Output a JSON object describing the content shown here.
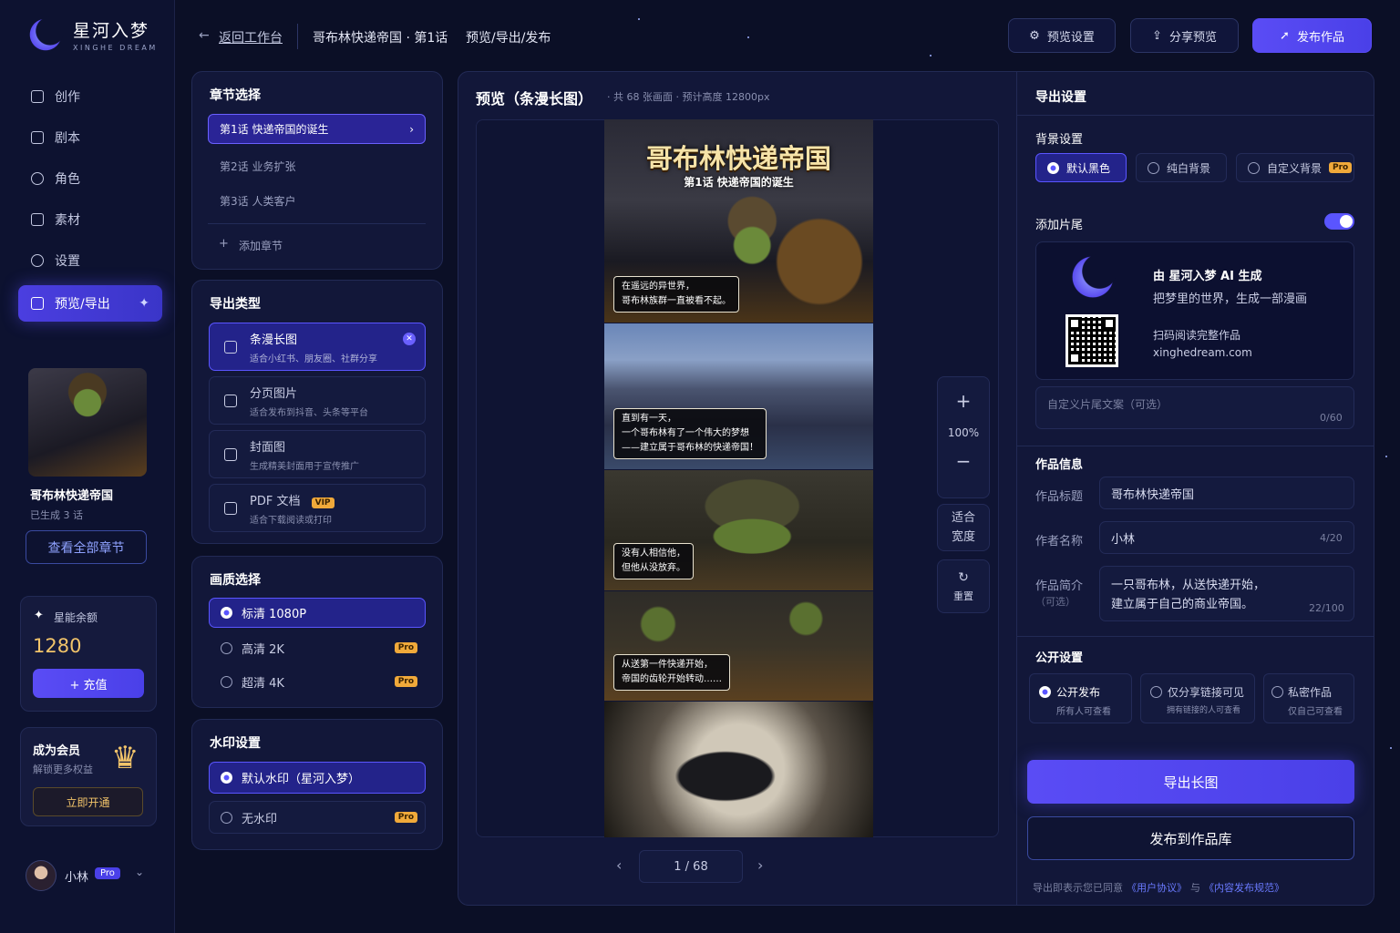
{
  "brand": {
    "name": "星河入梦",
    "sub": "XINGHE DREAM"
  },
  "nav": [
    {
      "label": "创作"
    },
    {
      "label": "剧本"
    },
    {
      "label": "角色"
    },
    {
      "label": "素材"
    },
    {
      "label": "设置"
    },
    {
      "label": "预览/导出"
    }
  ],
  "project": {
    "title": "哥布林快递帝国",
    "generated": "已生成 3 话",
    "view_all": "查看全部章节"
  },
  "energy": {
    "label": "星能余额",
    "value": "1280",
    "recharge": "+ 充值"
  },
  "member": {
    "title": "成为会员",
    "desc": "解锁更多权益",
    "cta": "立即开通"
  },
  "user": {
    "name": "小林",
    "badge": "Pro"
  },
  "header": {
    "back": "返回工作台",
    "title": "哥布林快递帝国 · 第1话",
    "section": "预览/导出/发布",
    "preview_settings": "预览设置",
    "share": "分享预览",
    "publish": "发布作品"
  },
  "chapters": {
    "title": "章节选择",
    "items": [
      "第1话  快递帝国的诞生",
      "第2话  业务扩张",
      "第3话  人类客户"
    ],
    "add": "添加章节"
  },
  "export_type": {
    "title": "导出类型",
    "items": [
      {
        "name": "条漫长图",
        "desc": "适合小红书、朋友圈、社群分享"
      },
      {
        "name": "分页图片",
        "desc": "适合发布到抖音、头条等平台"
      },
      {
        "name": "封面图",
        "desc": "生成精美封面用于宣传推广"
      },
      {
        "name": "PDF 文档",
        "desc": "适合下载阅读或打印",
        "tag": "VIP"
      }
    ]
  },
  "quality": {
    "title": "画质选择",
    "items": [
      {
        "name": "标清  1080P"
      },
      {
        "name": "高清  2K",
        "tag": "Pro"
      },
      {
        "name": "超清  4K",
        "tag": "Pro"
      }
    ]
  },
  "watermark": {
    "title": "水印设置",
    "items": [
      {
        "name": "默认水印（星河入梦）"
      },
      {
        "name": "无水印",
        "tag": "Pro"
      }
    ]
  },
  "preview": {
    "title": "预览（条漫长图）",
    "meta": "· 共 68 张画面 · 预计高度 12800px",
    "comic_title": "哥布林快递帝国",
    "comic_sub": "第1话  快递帝国的诞生",
    "bubbles": [
      "在遥远的异世界，\n哥布林族群一直被看不起。",
      "直到有一天，\n一个哥布林有了一个伟大的梦想\n——建立属于哥布林的快递帝国！",
      "没有人相信他，\n但他从没放弃。",
      "从送第一件快递开始，\n帝国的齿轮开始转动……"
    ],
    "zoom": "100%",
    "fit": "适合\n宽度",
    "reset": "重置",
    "page": "1 / 68"
  },
  "export_settings": {
    "title": "导出设置",
    "bg_title": "背景设置",
    "bg_options": [
      {
        "name": "默认黑色"
      },
      {
        "name": "纯白背景"
      },
      {
        "name": "自定义背景",
        "tag": "Pro"
      }
    ],
    "ending_title": "添加片尾",
    "ending_line1": "由 星河入梦 AI 生成",
    "ending_line2": "把梦里的世界，生成一部漫画",
    "ending_line3": "扫码阅读完整作品",
    "ending_url": "xinghedream.com",
    "custom_placeholder": "自定义片尾文案（可选）",
    "custom_count": "0/60"
  },
  "work_info": {
    "title": "作品信息",
    "title_label": "作品标题",
    "title_value": "哥布林快递帝国",
    "author_label": "作者名称",
    "author_value": "小林",
    "author_count": "4/20",
    "desc_label": "作品简介",
    "desc_optional": "（可选）",
    "desc_value": "一只哥布林，从送快递开始，\n建立属于自己的商业帝国。",
    "desc_count": "22/100"
  },
  "visibility": {
    "title": "公开设置",
    "options": [
      {
        "name": "公开发布",
        "desc": "所有人可查看"
      },
      {
        "name": "仅分享链接可见",
        "desc": "拥有链接的人可查看"
      },
      {
        "name": "私密作品",
        "desc": "仅自己可查看"
      }
    ]
  },
  "actions": {
    "export": "导出长图",
    "publish": "发布到作品库",
    "agree_pre": "导出即表示您已同意",
    "agree_link1": "《用户协议》",
    "agree_and": "与",
    "agree_link2": "《内容发布规范》"
  }
}
